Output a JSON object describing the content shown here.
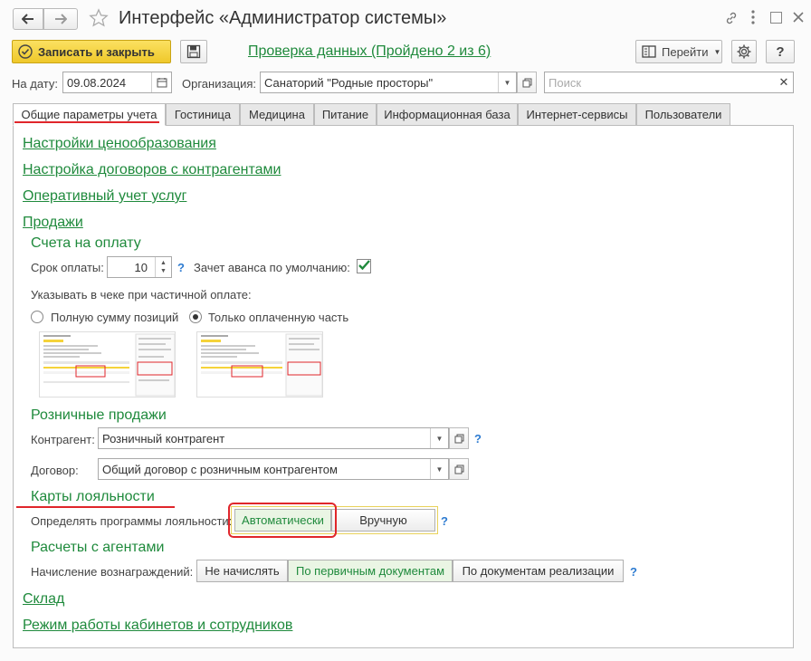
{
  "window": {
    "title": "Интерфейс «Администратор системы»"
  },
  "toolbar": {
    "save_close": "Записать и закрыть",
    "check_link": "Проверка данных (Пройдено 2 из 6)",
    "goto": "Перейти",
    "help": "?"
  },
  "filter": {
    "date_label": "На дату:",
    "date_value": "09.08.2024",
    "org_label": "Организация:",
    "org_value": "Санаторий \"Родные просторы\"",
    "search_placeholder": "Поиск"
  },
  "tabs": [
    "Общие параметры учета",
    "Гостиница",
    "Медицина",
    "Питание",
    "Информационная база",
    "Интернет-сервисы",
    "Пользователи"
  ],
  "sections": {
    "pricing": "Настройки ценообразования",
    "contracts": "Настройка договоров с контрагентами",
    "services": "Оперативный учет услуг",
    "sales": "Продажи",
    "warehouse": "Склад",
    "cabinets": "Режим работы кабинетов и сотрудников"
  },
  "invoices": {
    "title": "Счета на оплату",
    "term_label": "Срок оплаты:",
    "term_value": "10",
    "advance_label": "Зачет аванса по умолчанию:",
    "receipt_label": "Указывать в чеке при частичной оплате:",
    "opt_full": "Полную сумму позиций",
    "opt_paid": "Только оплаченную часть"
  },
  "retail": {
    "title": "Розничные продажи",
    "counterparty_label": "Контрагент:",
    "counterparty_value": "Розничный контрагент",
    "contract_label": "Договор:",
    "contract_value": "Общий договор с розничным контрагентом"
  },
  "loyalty": {
    "title": "Карты лояльности",
    "label": "Определять программы лояльности:",
    "auto": "Автоматически",
    "manual": "Вручную"
  },
  "agents": {
    "title": "Расчеты с агентами",
    "label": "Начисление вознаграждений:",
    "opt1": "Не начислять",
    "opt2": "По первичным документам",
    "opt3": "По документам реализации"
  },
  "colors": {
    "accent": "#1f8a3c",
    "highlight_red": "#e0262b",
    "save_yellow": "#f5d33a",
    "help_blue": "#2d7bd1"
  }
}
